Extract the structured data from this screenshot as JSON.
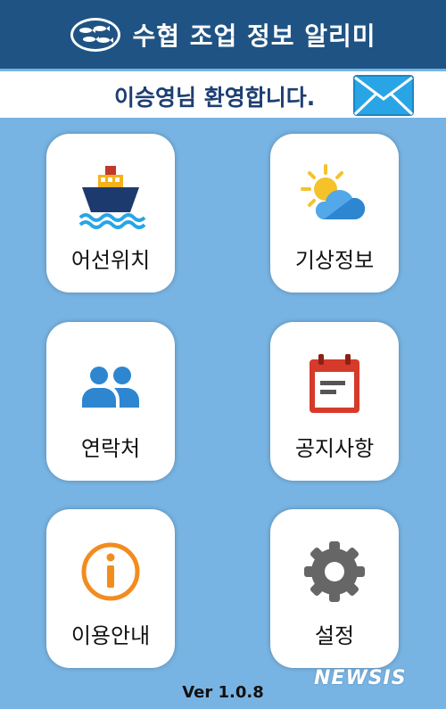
{
  "header": {
    "title": "수협 조업 정보 알리미",
    "logo_icon": "fish-logo-icon",
    "bg_color": "#1f5384"
  },
  "welcome": {
    "text": "이승영님 환영합니다.",
    "mail_icon": "envelope-icon"
  },
  "menu": [
    {
      "label": "어선위치",
      "icon": "ship-icon"
    },
    {
      "label": "기상정보",
      "icon": "weather-sun-cloud-icon"
    },
    {
      "label": "연락처",
      "icon": "contacts-people-icon"
    },
    {
      "label": "공지사항",
      "icon": "calendar-notice-icon"
    },
    {
      "label": "이용안내",
      "icon": "info-icon"
    },
    {
      "label": "설정",
      "icon": "gear-icon"
    }
  ],
  "footer": {
    "version": "Ver 1.0.8"
  },
  "watermark": "NEWSIS",
  "colors": {
    "background": "#78b4e3",
    "header": "#1f5384",
    "welcome_text": "#1d3f73",
    "accent_orange": "#f28c1e",
    "mail_blue": "#29a5e6"
  }
}
